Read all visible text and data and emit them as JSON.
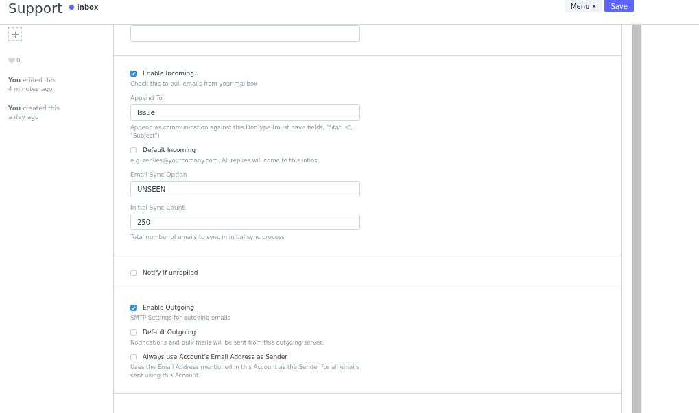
{
  "header": {
    "title": "Support",
    "status": {
      "label": "Inbox",
      "color": "#5e64ff"
    },
    "buttons": [
      {
        "label": "Menu",
        "kind": "dropdown"
      },
      {
        "label": "Save",
        "kind": "primary"
      }
    ]
  },
  "sidebar": {
    "likes": "0",
    "activity": [
      {
        "who": "You",
        "text": "edited this",
        "time": "4 minutes ago"
      },
      {
        "who": "You",
        "text": "created this",
        "time": "a day ago"
      }
    ]
  },
  "sections": [
    {
      "fields": [
        {
          "kind": "input"
        }
      ]
    },
    {
      "fields": [
        {
          "kind": "checkbox",
          "label": "Enable Incoming",
          "checked": true,
          "description": "Check this to pull emails from your mailbox"
        },
        {
          "kind": "input",
          "label": "Append To",
          "value": "Issue",
          "description": "Append as communication against this DocType (must have fields, \"Status\", \"Subject\")"
        },
        {
          "kind": "checkbox",
          "label": "Default Incoming",
          "checked": false,
          "description": "e.g. replies@yourcomany.com. All replies will come to this inbox."
        },
        {
          "kind": "input",
          "label": "Email Sync Option",
          "value": "UNSEEN"
        },
        {
          "kind": "input",
          "label": "Initial Sync Count",
          "value": "250",
          "description": "Total number of emails to sync in initial sync process"
        }
      ]
    },
    {
      "fields": [
        {
          "kind": "checkbox",
          "label": "Notify if unreplied",
          "checked": false
        }
      ]
    },
    {
      "fields": [
        {
          "kind": "checkbox",
          "label": "Enable Outgoing",
          "checked": true,
          "description": "SMTP Settings for outgoing emails"
        },
        {
          "kind": "checkbox",
          "label": "Default Outgoing",
          "checked": false,
          "description": "Notifications and bulk mails will be sent from this outgoing server."
        },
        {
          "kind": "checkbox",
          "label": "Always use Account's Email Address as Sender",
          "checked": false,
          "description": "Uses the Email Address mentioned in this Account as the Sender for all emails sent using this Account."
        }
      ]
    }
  ]
}
